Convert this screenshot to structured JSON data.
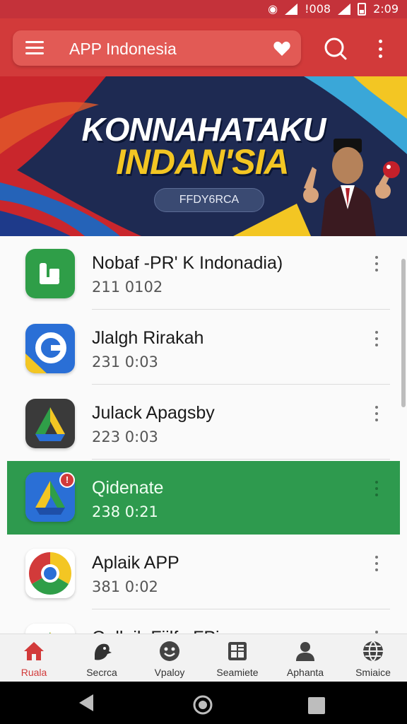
{
  "status_bar": {
    "battery_text": "!008",
    "time": "2:09"
  },
  "app_bar": {
    "title": "APP Indonesia"
  },
  "banner": {
    "title": "KONNAHATAKU",
    "subtitle": "INDAN'SIA",
    "button_label": "FFDY6RCA"
  },
  "list": {
    "items": [
      {
        "title": "Nobaf -PR' K Indonadia)",
        "subtitle": "211 0102",
        "icon": "green-phone-app-icon"
      },
      {
        "title": "Jlalgh Rirakah",
        "subtitle": "231 0:03",
        "icon": "google-g-app-icon"
      },
      {
        "title": "Julack Apagsby",
        "subtitle": "223 0:03",
        "icon": "drive-triangle-app-icon"
      },
      {
        "title": "Qidenate",
        "subtitle": "238 0:21",
        "icon": "drive-badge-app-icon",
        "badge": "!"
      },
      {
        "title": "Aplaik APP",
        "subtitle": "381 0:02",
        "icon": "chrome-app-icon"
      },
      {
        "title": "Gollaik Fiilfe FPi",
        "subtitle": "",
        "icon": "drive-triangle-app-icon"
      }
    ]
  },
  "bottom_nav": {
    "items": [
      {
        "label": "Ruala",
        "icon": "home-icon",
        "active": true
      },
      {
        "label": "Secrca",
        "icon": "search-bird-icon",
        "active": false
      },
      {
        "label": "Vpaloy",
        "icon": "emoji-icon",
        "active": false
      },
      {
        "label": "Seamiete",
        "icon": "grid-icon",
        "active": false
      },
      {
        "label": "Aphanta",
        "icon": "person-icon",
        "active": false
      },
      {
        "label": "Smiaice",
        "icon": "globe-icon",
        "active": false
      }
    ]
  },
  "colors": {
    "primary": "#d23a3a",
    "selected_row": "#2e9a4e",
    "banner_gold": "#f3c623"
  }
}
